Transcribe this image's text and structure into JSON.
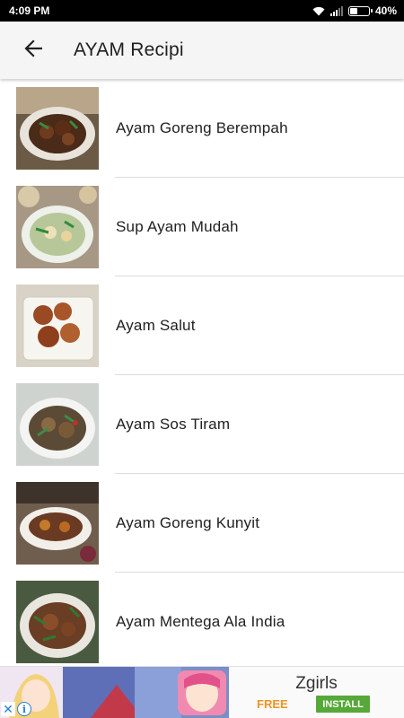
{
  "status_bar": {
    "time": "4:09 PM",
    "battery": "40%",
    "battery_level": 0.4,
    "icons": [
      "wifi-icon",
      "signal-icon",
      "battery-icon"
    ]
  },
  "app_bar": {
    "back_icon": "arrow-back-icon",
    "title": "AYAM Recipi"
  },
  "recipes": [
    {
      "label": "Ayam Goreng Berempah"
    },
    {
      "label": "Sup Ayam Mudah"
    },
    {
      "label": "Ayam Salut"
    },
    {
      "label": "Ayam Sos Tiram"
    },
    {
      "label": "Ayam Goreng Kunyit"
    },
    {
      "label": "Ayam Mentega Ala India"
    }
  ],
  "ad": {
    "app_name": "Zgirls",
    "price": "FREE",
    "install_label": "INSTALL",
    "close_icon": "close-icon",
    "info_icon": "info-icon",
    "colors": {
      "install": "#56a838",
      "free": "#f0931f",
      "ad_icon": "#2a7fd4"
    }
  }
}
